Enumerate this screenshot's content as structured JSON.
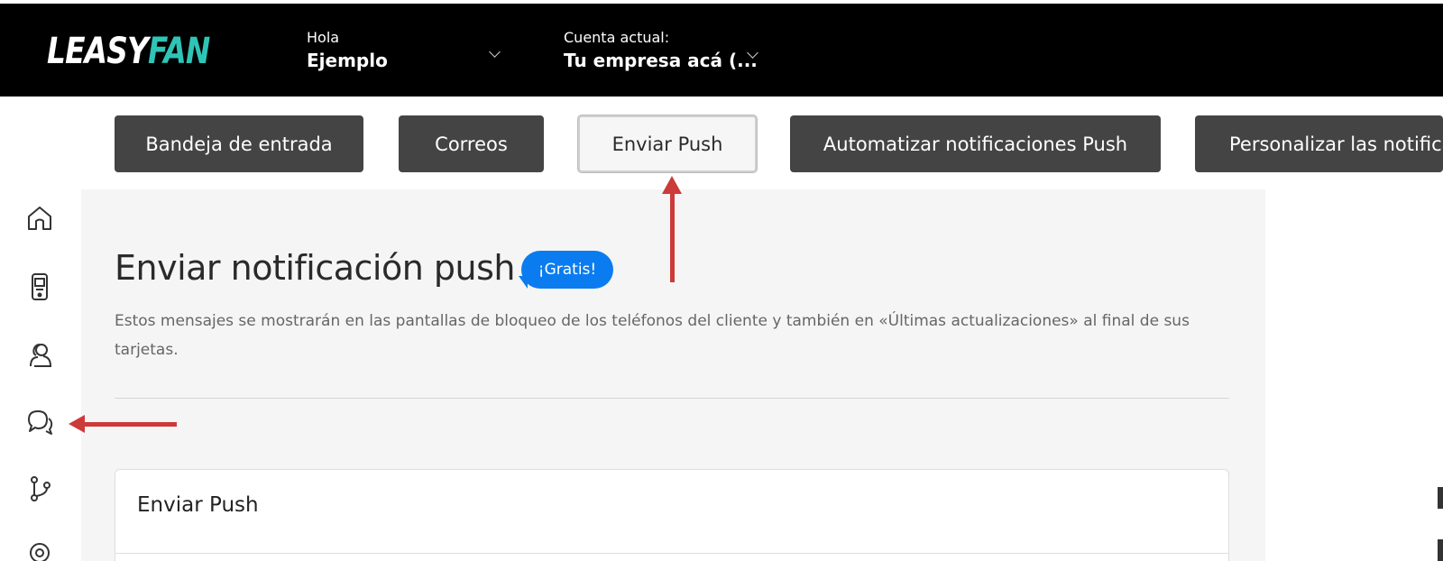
{
  "header": {
    "logo_part1": "LEASY",
    "logo_part2": "FAN",
    "greeting_label": "Hola",
    "user_name": "Ejemplo",
    "account_label": "Cuenta actual:",
    "account_name": "Tu empresa acá (..."
  },
  "tabs": [
    {
      "label": "Bandeja de entrada"
    },
    {
      "label": "Correos"
    },
    {
      "label": "Enviar Push",
      "active": true
    },
    {
      "label": "Automatizar notificaciones Push"
    },
    {
      "label": "Personalizar las notifica"
    }
  ],
  "sidebar": {
    "icons": [
      "home-icon",
      "mobile-device-icon",
      "users-icon",
      "chat-icon",
      "flow-icon",
      "location-icon"
    ]
  },
  "main": {
    "title": "Enviar notificación push",
    "badge": "¡Gratis!",
    "description": "Estos mensajes se mostrarán en las pantallas de bloqueo de los teléfonos del cliente y también en «Últimas actualizaciones» al final de sus tarjetas.",
    "card_title": "Enviar Push"
  },
  "colors": {
    "header_bg": "#000000",
    "logo_accent": "#2ec4b6",
    "tab_bg": "#444444",
    "badge_bg": "#0a7cf0",
    "annotation_arrow": "#cc3a3a"
  }
}
